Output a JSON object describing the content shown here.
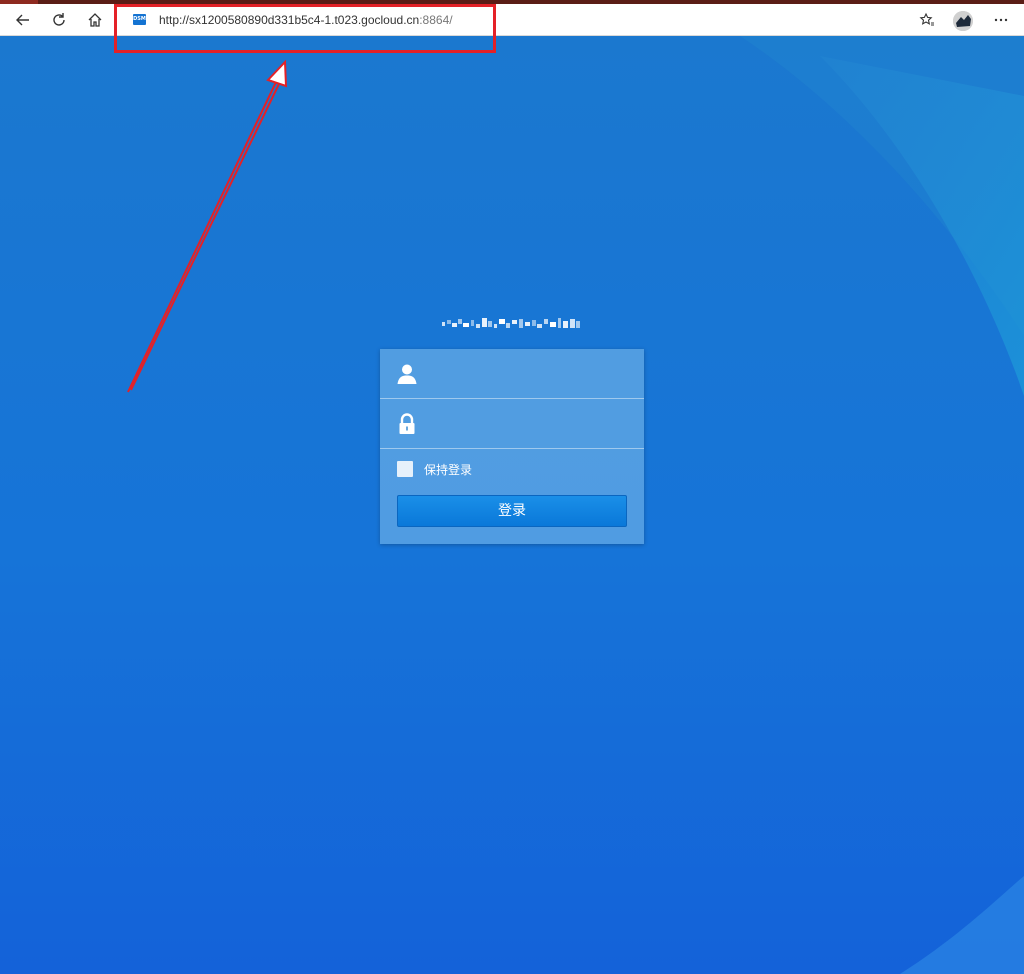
{
  "browser": {
    "url_main": "http://sx1200580890d331b5c4-1.t023.gocloud.cn",
    "url_port": ":8864/",
    "favicon_label": "DSM"
  },
  "login": {
    "username_placeholder": "",
    "password_placeholder": "",
    "remember_label": "保持登录",
    "submit_label": "登录"
  },
  "colors": {
    "background": "#1a74d4",
    "annotation": "#e42127",
    "button": "#0a78d9"
  },
  "icons": [
    "back-icon",
    "refresh-icon",
    "home-icon",
    "favorites-icon",
    "more-icon",
    "user-icon",
    "lock-icon"
  ]
}
